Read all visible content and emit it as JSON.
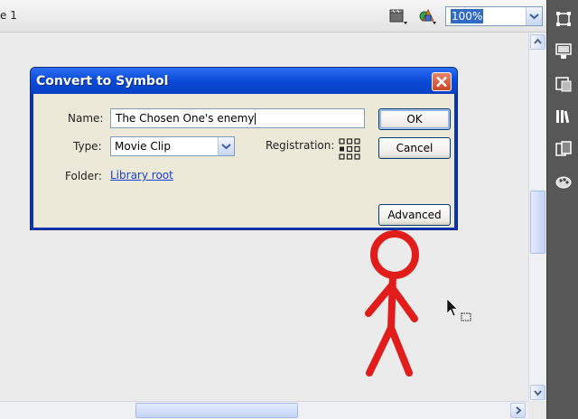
{
  "toolbar": {
    "scene_label": "e 1",
    "zoom_value": "100%"
  },
  "dialog": {
    "title": "Convert to Symbol",
    "name_label": "Name:",
    "name_value": "The Chosen One's enemy",
    "type_label": "Type:",
    "type_value": "Movie Clip",
    "registration_label": "Registration:",
    "folder_label": "Folder:",
    "folder_link": "Library root",
    "ok_label": "OK",
    "cancel_label": "Cancel",
    "advanced_label": "Advanced"
  },
  "icons": {
    "toolbar": [
      "edit-scene-icon",
      "edit-symbols-icon"
    ],
    "right_panel": [
      "transform-icon",
      "align-icon",
      "info-icon",
      "library-icon",
      "swatches-icon",
      "color-icon"
    ],
    "stage": [
      "stick-figure",
      "arrow-cursor-icon"
    ]
  },
  "colors": {
    "title_bar": "#0b4ad8",
    "dialog_body": "#ece9d8",
    "stick_figure": "#e21b1b",
    "right_panel": "#575757"
  }
}
